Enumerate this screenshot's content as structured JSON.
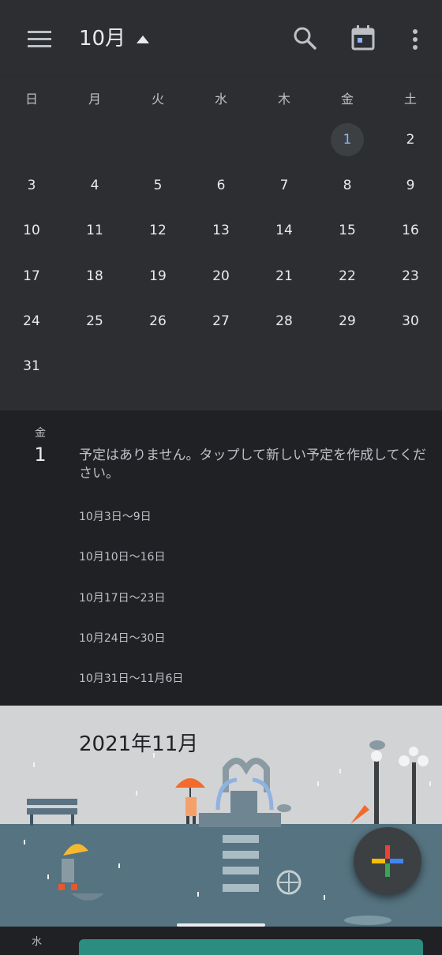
{
  "header": {
    "month_label": "10月",
    "icons": [
      "menu-icon",
      "dropdown-arrow-icon",
      "search-icon",
      "today-icon",
      "more-vert-icon"
    ]
  },
  "calendar": {
    "weekdays": [
      "日",
      "月",
      "火",
      "水",
      "木",
      "金",
      "土"
    ],
    "today": "1",
    "rows": [
      [
        "",
        "",
        "",
        "",
        "",
        "1",
        "2"
      ],
      [
        "3",
        "4",
        "5",
        "6",
        "7",
        "8",
        "9"
      ],
      [
        "10",
        "11",
        "12",
        "13",
        "14",
        "15",
        "16"
      ],
      [
        "17",
        "18",
        "19",
        "20",
        "21",
        "22",
        "23"
      ],
      [
        "24",
        "25",
        "26",
        "27",
        "28",
        "29",
        "30"
      ],
      [
        "31",
        "",
        "",
        "",
        "",
        "",
        ""
      ]
    ]
  },
  "agenda": {
    "selected_dow": "金",
    "selected_day": "1",
    "no_events_text": "予定はありません。タップして新しい予定を作成してください。",
    "weeks": [
      "10月3日～9日",
      "10月10日～16日",
      "10月17日～23日",
      "10月24日～30日",
      "10月31日～11月6日"
    ]
  },
  "month_banner": {
    "title": "2021年11月"
  },
  "bottom": {
    "dow": "水"
  },
  "colors": {
    "accent": "#8ab4f8",
    "event_chip": "#2a8d80",
    "umbrella": "#f26b2c"
  }
}
